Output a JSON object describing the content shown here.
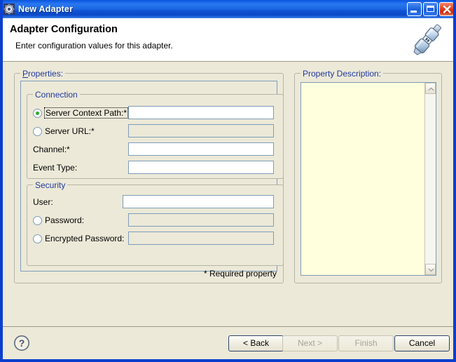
{
  "window": {
    "title": "New Adapter",
    "icon": "gear-icon",
    "controls": {
      "minimize": "Minimize",
      "maximize": "Maximize",
      "close": "Close"
    }
  },
  "header": {
    "title": "Adapter Configuration",
    "subtitle": "Enter configuration values for this adapter.",
    "icon": "plug-adapter-icon"
  },
  "properties": {
    "legend_mnemonic": "P",
    "legend_rest": "roperties:",
    "required_note": "* Required property",
    "connection": {
      "legend": "Connection",
      "fields": [
        {
          "label": "Server Context Path:*",
          "type": "radio-text",
          "selected": true,
          "focused": true,
          "value": "",
          "enabled": true
        },
        {
          "label": "Server URL:*",
          "type": "radio-text",
          "selected": false,
          "focused": false,
          "value": "",
          "enabled": false
        },
        {
          "label": "Channel:*",
          "type": "text",
          "value": "",
          "enabled": true
        },
        {
          "label": "Event Type:",
          "type": "text",
          "value": "",
          "enabled": true
        }
      ]
    },
    "security": {
      "legend": "Security",
      "fields": [
        {
          "label": "User:",
          "type": "text",
          "value": "",
          "enabled": true
        },
        {
          "label": "Password:",
          "type": "radio-text",
          "selected": false,
          "value": "",
          "enabled": false
        },
        {
          "label": "Encrypted Password:",
          "type": "radio-text",
          "selected": false,
          "value": "",
          "enabled": false
        }
      ]
    }
  },
  "description": {
    "legend": "Property Description:",
    "text": "",
    "scrollbar": {
      "up": "scroll-up",
      "down": "scroll-down"
    }
  },
  "footer": {
    "help": "?",
    "buttons": [
      {
        "label": "< Back",
        "mnemonic": "B",
        "enabled": true,
        "default": true
      },
      {
        "label": "Next >",
        "mnemonic": "N",
        "enabled": false,
        "default": false
      },
      {
        "label": "Finish",
        "mnemonic": "F",
        "enabled": false,
        "default": false
      },
      {
        "label": "Cancel",
        "mnemonic": "",
        "enabled": true,
        "default": true
      }
    ]
  },
  "colors": {
    "dialog_bg": "#ece9d8",
    "titlebar_blue": "#1560e8",
    "frame_blue": "#0a3fd0",
    "group_legend": "#22399c",
    "field_border": "#7f9db9",
    "description_bg": "#ffffdd",
    "radio_dot_green": "#2faa2f",
    "close_red": "#df3c1b"
  }
}
